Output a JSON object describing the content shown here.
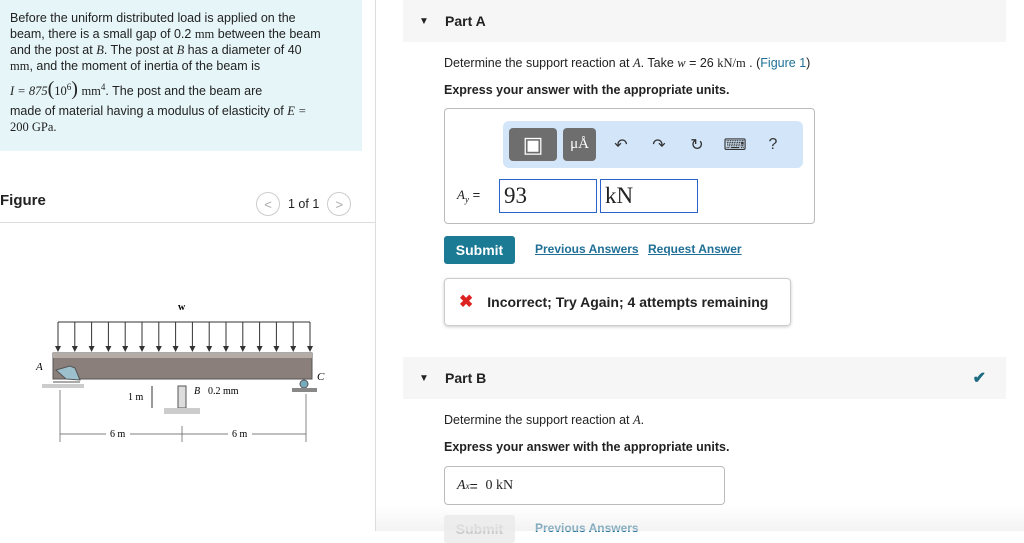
{
  "problem": {
    "line1": "Before the uniform distributed load is applied on the",
    "line2a": "beam, there is a small gap of 0.2 ",
    "line2b": "mm",
    "line2c": " between the beam",
    "line3a": "and the post at ",
    "line3b": "B",
    "line3c": ". The post at ",
    "line3d": "B",
    "line3e": " has a diameter of 40",
    "line4a": "mm",
    "line4b": ", and the moment of inertia of the beam is",
    "line5a": "I = 875",
    "line5b": "10",
    "line5c": "6",
    "line5d": "mm",
    "line5e": "4",
    "line5f": ". The post and the beam are",
    "line6a": "made of material having a modulus of elasticity of ",
    "line6b": "E =",
    "line7": "200 GPa."
  },
  "figure": {
    "title": "Figure",
    "pager": "1 of 1",
    "prev": "<",
    "next": ">",
    "labels": {
      "w": "w",
      "A": "A",
      "B": "B",
      "C": "C",
      "gap": "0.2 mm",
      "post": "1 m",
      "span1": "6 m",
      "span2": "6 m"
    }
  },
  "partA": {
    "title": "Part A",
    "question_a": "Determine the support reaction at ",
    "question_b": "A",
    ". Take ": "",
    "question_c": ". Take ",
    "question_d": "w",
    "question_e": " = 26 ",
    "question_f": "kN/m",
    "question_g": " . (",
    "figure_link": "Figure 1",
    "question_h": ")",
    "instruction": "Express your answer with the appropriate units.",
    "toolbar": {
      "templates": "▣",
      "units": "μÅ",
      "undo": "↶",
      "redo": "↷",
      "reset": "↻",
      "keyboard": "⌨",
      "help": "?"
    },
    "var_label": "A",
    "var_sub": "y",
    "eq": " =",
    "value": "93",
    "unit": "kN",
    "submit": "Submit",
    "previous_answers": "Previous Answers",
    "request_answer": "Request Answer",
    "feedback": "Incorrect; Try Again; 4 attempts remaining"
  },
  "partB": {
    "title": "Part B",
    "question_a": "Determine the support reaction at ",
    "question_b": "A",
    "question_c": ".",
    "instruction": "Express your answer with the appropriate units.",
    "var_label": "A",
    "var_sub": "x",
    "eq": " =",
    "answer": "0 kN",
    "submit": "Submit",
    "previous_answers": "Previous Answers"
  },
  "colors": {
    "accent": "#1b7a94",
    "problem_bg": "#e6f5f8",
    "error": "#dd2222"
  }
}
